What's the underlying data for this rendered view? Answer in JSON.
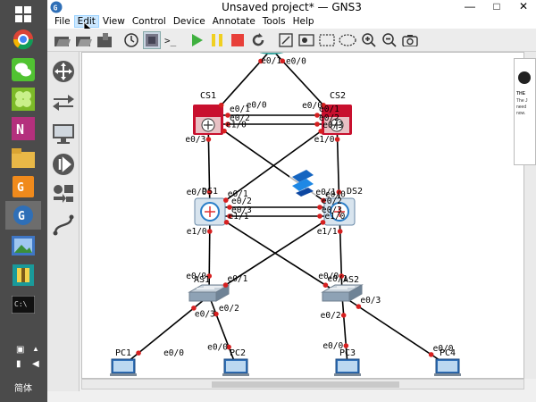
{
  "window": {
    "title": "Unsaved project* — GNS3",
    "controls": {
      "minimize": "—",
      "maximize": "□",
      "close": "✕"
    }
  },
  "menu": [
    "File",
    "Edit",
    "View",
    "Control",
    "Device",
    "Annotate",
    "Tools",
    "Help"
  ],
  "menu_hover_index": 1,
  "taskbar": {
    "apps": [
      "windows-icon",
      "chrome-icon",
      "wechat-icon",
      "clover-icon",
      "onenote-icon",
      "folder-icon",
      "pdf-icon",
      "gns3-icon",
      "image-viewer-icon",
      "archive-icon",
      "console-icon"
    ],
    "ime": "简体"
  },
  "popup": {
    "title": "THE",
    "line1": "The J",
    "line2": "need",
    "line3": "now."
  },
  "topology": {
    "nodes": [
      {
        "id": "CS1",
        "label": "CS1",
        "type": "l3switch"
      },
      {
        "id": "CS2",
        "label": "CS2",
        "type": "l3switch"
      },
      {
        "id": "DS1",
        "label": "DS1",
        "type": "router"
      },
      {
        "id": "DS2",
        "label": "DS2",
        "type": "router"
      },
      {
        "id": "AS1",
        "label": "AS1",
        "type": "switch"
      },
      {
        "id": "AS2",
        "label": "AS2",
        "type": "switch"
      },
      {
        "id": "PC1",
        "label": "PC1",
        "type": "pc"
      },
      {
        "id": "PC2",
        "label": "PC2",
        "type": "pc"
      },
      {
        "id": "PC3",
        "label": "PC3",
        "type": "pc"
      },
      {
        "id": "PC4",
        "label": "PC4",
        "type": "pc"
      }
    ],
    "links": [
      {
        "a": "top",
        "b": "CS1",
        "a_if": "e0/0",
        "b_if": "e0/0"
      },
      {
        "a": "top",
        "b": "CS2",
        "a_if": "e0/1",
        "b_if": "e0/0"
      },
      {
        "a": "CS1",
        "b": "CS2",
        "a_if": "e0/1",
        "b_if": "e0/1"
      },
      {
        "a": "CS1",
        "b": "CS2",
        "a_if": "e0/2",
        "b_if": "e0/2"
      },
      {
        "a": "CS1",
        "b": "DS1",
        "a_if": "e0/3",
        "b_if": "e0/0"
      },
      {
        "a": "CS1",
        "b": "DS2",
        "a_if": "e1/0",
        "b_if": "e0/0"
      },
      {
        "a": "CS2",
        "b": "DS1",
        "a_if": "e0/3",
        "b_if": "e0/1"
      },
      {
        "a": "CS2",
        "b": "DS2",
        "a_if": "e1/0",
        "b_if": "e0/1"
      },
      {
        "a": "DS1",
        "b": "DS2",
        "a_if": "e0/2",
        "b_if": "e0/2"
      },
      {
        "a": "DS1",
        "b": "DS2",
        "a_if": "e0/3",
        "b_if": "e0/3"
      },
      {
        "a": "DS1",
        "b": "AS1",
        "a_if": "e1/0",
        "b_if": "e0/0"
      },
      {
        "a": "DS1",
        "b": "AS2",
        "a_if": "e1/1",
        "b_if": "e0/1"
      },
      {
        "a": "DS2",
        "b": "AS1",
        "a_if": "e1/0",
        "b_if": "e0/1"
      },
      {
        "a": "DS2",
        "b": "AS2",
        "a_if": "e1/1",
        "b_if": "e0/0"
      },
      {
        "a": "AS1",
        "b": "PC1",
        "a_if": "e0/2",
        "b_if": "e0/0"
      },
      {
        "a": "AS1",
        "b": "PC2",
        "a_if": "e0/3",
        "b_if": "e0/0"
      },
      {
        "a": "AS2",
        "b": "PC3",
        "a_if": "e0/2",
        "b_if": "e0/0"
      },
      {
        "a": "AS2",
        "b": "PC4",
        "a_if": "e0/3",
        "b_if": "e0/0"
      }
    ]
  },
  "colors": {
    "link": "#000000",
    "port": "#d62020",
    "l3switch": "#c8102e",
    "router": "#2a7ec8",
    "accent": "#1e6fd0"
  }
}
